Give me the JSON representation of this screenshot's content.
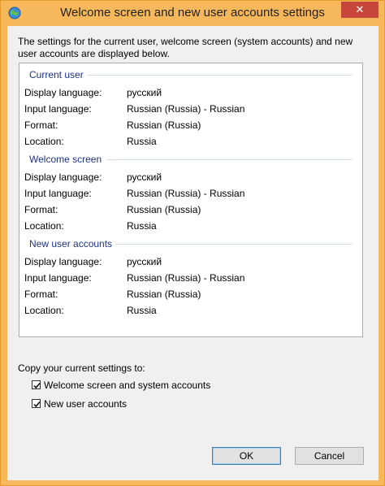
{
  "window": {
    "title": "Welcome screen and new user accounts settings",
    "close_glyph": "✕",
    "accent": "#f7b75b"
  },
  "description": "The settings for the current user, welcome screen (system accounts) and new user accounts are displayed below.",
  "sections": [
    {
      "header": "Current user",
      "rows": [
        {
          "label": "Display language:",
          "value": "русский"
        },
        {
          "label": "Input language:",
          "value": "Russian (Russia) - Russian"
        },
        {
          "label": "Format:",
          "value": "Russian (Russia)"
        },
        {
          "label": "Location:",
          "value": "Russia"
        }
      ]
    },
    {
      "header": "Welcome screen",
      "rows": [
        {
          "label": "Display language:",
          "value": "русский"
        },
        {
          "label": "Input language:",
          "value": "Russian (Russia) - Russian"
        },
        {
          "label": "Format:",
          "value": "Russian (Russia)"
        },
        {
          "label": "Location:",
          "value": "Russia"
        }
      ]
    },
    {
      "header": "New user accounts",
      "rows": [
        {
          "label": "Display language:",
          "value": "русский"
        },
        {
          "label": "Input language:",
          "value": "Russian (Russia) - Russian"
        },
        {
          "label": "Format:",
          "value": "Russian (Russia)"
        },
        {
          "label": "Location:",
          "value": "Russia"
        }
      ]
    }
  ],
  "copy": {
    "label": "Copy your current settings to:",
    "options": [
      {
        "label": "Welcome screen and system accounts",
        "checked": true
      },
      {
        "label": "New user accounts",
        "checked": true
      }
    ]
  },
  "buttons": {
    "ok": "OK",
    "cancel": "Cancel"
  }
}
